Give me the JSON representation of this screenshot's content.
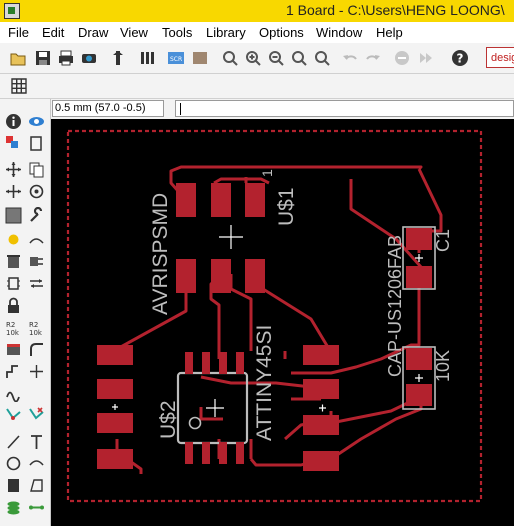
{
  "window": {
    "title": "1 Board - C:\\Users\\HENG LOONG\\"
  },
  "menu": [
    "File",
    "Edit",
    "Draw",
    "View",
    "Tools",
    "Library",
    "Options",
    "Window",
    "Help"
  ],
  "toolbar": {
    "design_label": "design",
    "icons": [
      "open-icon",
      "save-icon",
      "print-icon",
      "cam-icon",
      "script-icon",
      "ulp-icon",
      "drc-icon",
      "layer-icon",
      "zoom-fit-icon",
      "zoom-in-icon",
      "zoom-out-icon",
      "zoom-redraw-icon",
      "zoom-select-icon",
      "undo-icon",
      "redo-icon",
      "stop-icon",
      "go-icon",
      "help-icon"
    ]
  },
  "grid_toolbar": {
    "icon": "grid-icon"
  },
  "coordinate_display": "0.5 mm (57.0 -0.5)",
  "command_input": {
    "value": ""
  },
  "sidebar_tools": [
    "info",
    "show",
    "display",
    "mark",
    "move",
    "copy",
    "mirror",
    "rotate",
    "group",
    "change",
    "paste",
    "delete",
    "add",
    "pinswap",
    "replace",
    "lock",
    "name",
    "value",
    "split",
    "miter",
    "optimize",
    "route",
    "ripup",
    "wire",
    "text",
    "circle",
    "arc",
    "rect",
    "polygon",
    "via",
    "signal"
  ],
  "board": {
    "labels": {
      "avr": "AVRISPSMD",
      "u1": "U$1",
      "tiny": "ATTINY45SI",
      "u2": "U$2",
      "cap": "CAP-US1206FAB",
      "c1": "C1",
      "r": "10K",
      "pin1": "1"
    },
    "colors": {
      "pad": "#b3222e",
      "trace": "#b3222e",
      "outline": "#bdbdbd",
      "dimension": "#b3222e",
      "background": "#000000"
    }
  }
}
